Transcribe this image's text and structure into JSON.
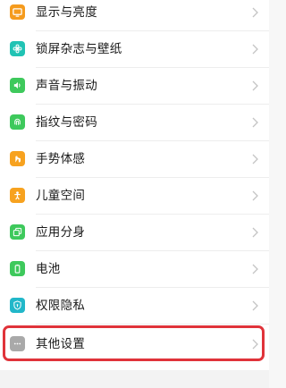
{
  "settings": {
    "items": [
      {
        "label": "显示与亮度",
        "icon": "display-icon",
        "color": "#f59b1d"
      },
      {
        "label": "锁屏杂志与壁纸",
        "icon": "wallpaper-icon",
        "color": "#21c3b4"
      },
      {
        "label": "声音与振动",
        "icon": "sound-icon",
        "color": "#3ec95c"
      },
      {
        "label": "指纹与密码",
        "icon": "fingerprint-icon",
        "color": "#3ec95c"
      },
      {
        "label": "手势体感",
        "icon": "gesture-icon",
        "color": "#f7a21f"
      },
      {
        "label": "儿童空间",
        "icon": "child-icon",
        "color": "#f7a21f"
      },
      {
        "label": "应用分身",
        "icon": "app-clone-icon",
        "color": "#3ec95c"
      },
      {
        "label": "电池",
        "icon": "battery-icon",
        "color": "#3ec95c"
      },
      {
        "label": "权限隐私",
        "icon": "privacy-shield-icon",
        "color": "#21b7c9"
      },
      {
        "label": "其他设置",
        "icon": "more-icon",
        "color": "#a9a9a9"
      }
    ]
  },
  "highlight_color": "#e0333a"
}
